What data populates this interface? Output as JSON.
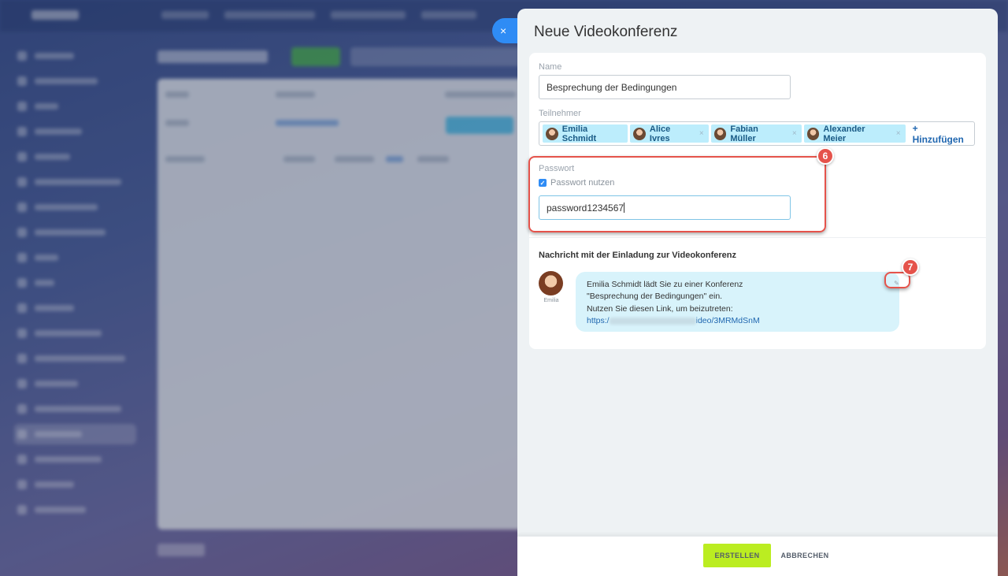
{
  "slider": {
    "close_glyph": "×",
    "title": "Neue Videokonferenz"
  },
  "form": {
    "name_label": "Name",
    "name_value": "Besprechung der Bedingungen",
    "participants_label": "Teilnehmer",
    "participants": [
      {
        "name": "Emilia Schmidt",
        "removable": false
      },
      {
        "name": "Alice Ivres",
        "removable": true
      },
      {
        "name": "Fabian Müller",
        "removable": true
      },
      {
        "name": "Alexander Meier",
        "removable": true
      }
    ],
    "add_participant": "+ Hinzufügen",
    "password_label": "Passwort",
    "use_password_label": "Passwort nutzen",
    "use_password_checked": true,
    "password_value": "password1234567"
  },
  "invitation": {
    "section_title": "Nachricht mit der Einladung zur Videokonferenz",
    "sender_name": "Emilia",
    "line1": "Emilia Schmidt lädt Sie zu einer Konferenz",
    "line2": "\"Besprechung der Bedingungen\" ein.",
    "line3": "Nutzen Sie diesen Link, um beizutreten:",
    "link_prefix": "https:/",
    "link_suffix": "ideo/3MRMdSnM"
  },
  "annotations": {
    "badge_password": "6",
    "badge_edit": "7"
  },
  "footer": {
    "create_label": "ERSTELLEN",
    "cancel_label": "ABBRECHEN"
  },
  "colors": {
    "accent_blue": "#2f8cf5",
    "create_green": "#bbed21",
    "chip_bg": "#bcedfc",
    "highlight_red": "#e5534b",
    "bubble_bg": "#d8f3fb"
  }
}
